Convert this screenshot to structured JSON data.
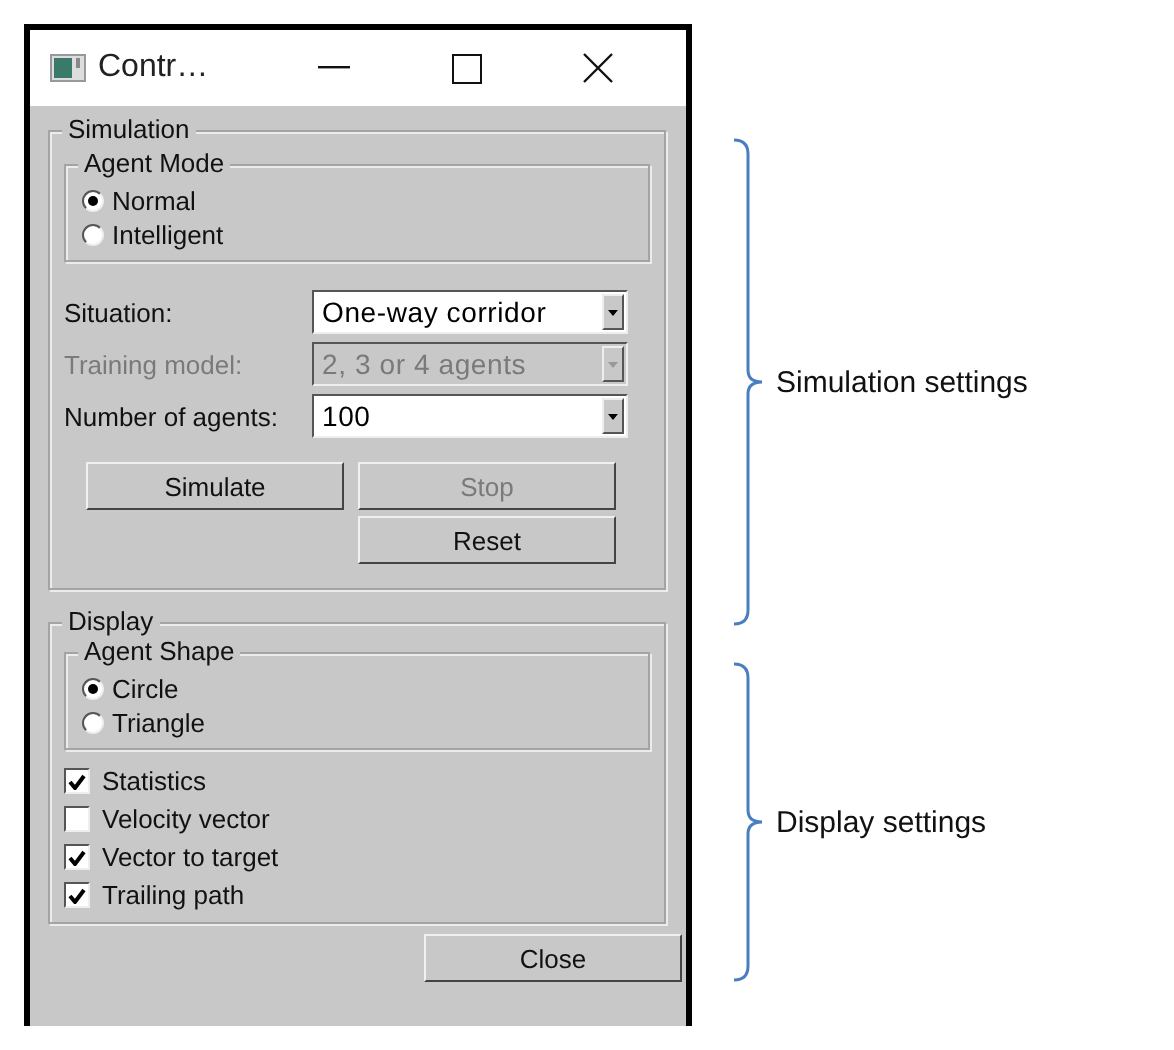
{
  "window": {
    "title": "Contr…"
  },
  "simulation": {
    "legend": "Simulation",
    "agent_mode": {
      "legend": "Agent Mode",
      "options": [
        {
          "label": "Normal",
          "selected": true
        },
        {
          "label": "Intelligent",
          "selected": false
        }
      ]
    },
    "fields": [
      {
        "label": "Situation:",
        "value": "One-way corridor",
        "disabled": false
      },
      {
        "label": "Training model:",
        "value": "2, 3 or 4 agents",
        "disabled": true
      },
      {
        "label": "Number of agents:",
        "value": "100",
        "disabled": false
      }
    ],
    "buttons": [
      {
        "label": "Simulate",
        "disabled": false
      },
      {
        "label": "Stop",
        "disabled": true
      },
      {
        "label": "Reset",
        "disabled": false
      }
    ]
  },
  "display": {
    "legend": "Display",
    "agent_shape": {
      "legend": "Agent Shape",
      "options": [
        {
          "label": "Circle",
          "selected": true
        },
        {
          "label": "Triangle",
          "selected": false
        }
      ]
    },
    "checkboxes": [
      {
        "label": "Statistics",
        "checked": true
      },
      {
        "label": "Velocity vector",
        "checked": false
      },
      {
        "label": "Vector to target",
        "checked": true
      },
      {
        "label": "Trailing path",
        "checked": true
      }
    ]
  },
  "close_button": "Close",
  "annotations": [
    {
      "label": "Simulation settings"
    },
    {
      "label": "Display settings"
    }
  ]
}
